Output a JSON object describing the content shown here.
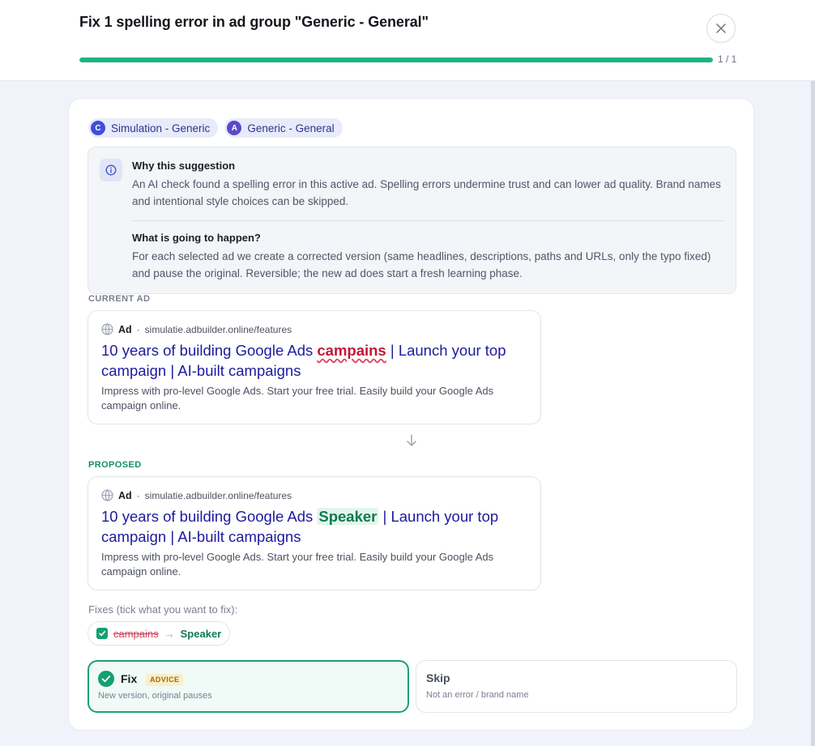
{
  "header": {
    "title": "Fix 1 spelling error in ad group \"Generic - General\"",
    "progress_count": "1 / 1",
    "progress_fraction": 1.0
  },
  "chips": [
    {
      "badge": "C",
      "label": "Simulation - Generic",
      "badge_color": "#3f4fd6"
    },
    {
      "badge": "A",
      "label": "Generic - General",
      "badge_color": "#5b49c9"
    }
  ],
  "info": {
    "why_title": "Why this suggestion",
    "why_text": "An AI check found a spelling error in this active ad. Spelling errors undermine trust and can lower ad quality. Brand names and intentional style choices can be skipped.",
    "what_title": "What is going to happen?",
    "what_text": "For each selected ad we create a corrected version (same headlines, descriptions, paths and URLs, only the typo fixed) and pause the original. Reversible; the new ad does start a fresh learning phase."
  },
  "current": {
    "label": "CURRENT AD",
    "ad_word": "Ad",
    "separator": "·",
    "url": "simulatie.adbuilder.online/features",
    "headline_pre": "10 years of building Google Ads ",
    "headline_mark": "campains",
    "headline_post": " | Launch your top campaign | AI-built campaigns",
    "description": "Impress with pro-level Google Ads. Start your free trial. Easily build your Google Ads campaign online."
  },
  "proposed": {
    "label": "PROPOSED",
    "ad_word": "Ad",
    "separator": "·",
    "url": "simulatie.adbuilder.online/features",
    "headline_pre": "10 years of building Google Ads ",
    "headline_mark": "Speaker",
    "headline_post": " | Launch your top campaign | AI-built campaigns",
    "description": "Impress with pro-level Google Ads. Start your free trial. Easily build your Google Ads campaign online."
  },
  "fixes": {
    "label": "Fixes (tick what you want to fix):",
    "items": [
      {
        "from": "campains",
        "arrow": "→",
        "to": "Speaker",
        "checked": true
      }
    ]
  },
  "options": {
    "fix": {
      "title": "Fix",
      "badge": "ADVICE",
      "sub": "New version, original pauses",
      "selected": true
    },
    "skip": {
      "title": "Skip",
      "sub": "Not an error / brand name",
      "selected": false
    }
  },
  "colors": {
    "accent": "#1aa276",
    "headline": "#1d1a9e",
    "error": "#c0183a"
  }
}
